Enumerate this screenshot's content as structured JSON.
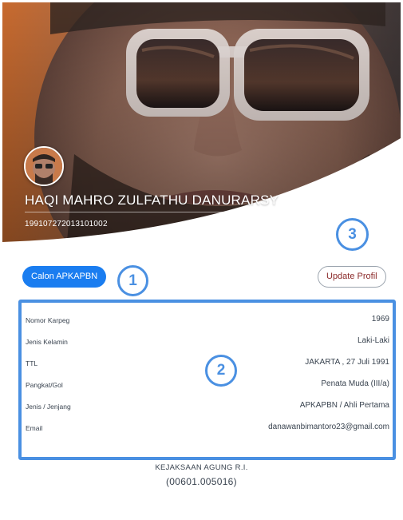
{
  "profile": {
    "name": "HAQI MAHRO ZULFATHU DANURARSY",
    "nip": "199107272013101002"
  },
  "actions": {
    "status_label": "Calon APKAPBN",
    "update_label": "Update Profil"
  },
  "markers": {
    "one": "1",
    "two": "2",
    "three": "3"
  },
  "details": [
    {
      "label": "Nomor Karpeg",
      "value": "1969"
    },
    {
      "label": "Jenis Kelamin",
      "value": "Laki-Laki"
    },
    {
      "label": "TTL",
      "value": "JAKARTA , 27 Juli 1991"
    },
    {
      "label": "Pangkat/Gol",
      "value": "Penata Muda (III/a)"
    },
    {
      "label": "Jenis / Jenjang",
      "value": "APKAPBN / Ahli Pertama"
    },
    {
      "label": "Email",
      "value": "danawanbimantoro23@gmail.com"
    }
  ],
  "organization": {
    "name": "KEJAKSAAN AGUNG R.I.",
    "code": "(00601.005016)"
  },
  "colors": {
    "accent": "#1a7df0",
    "annotation": "#4a90e2",
    "update_text": "#8b2a2a"
  }
}
